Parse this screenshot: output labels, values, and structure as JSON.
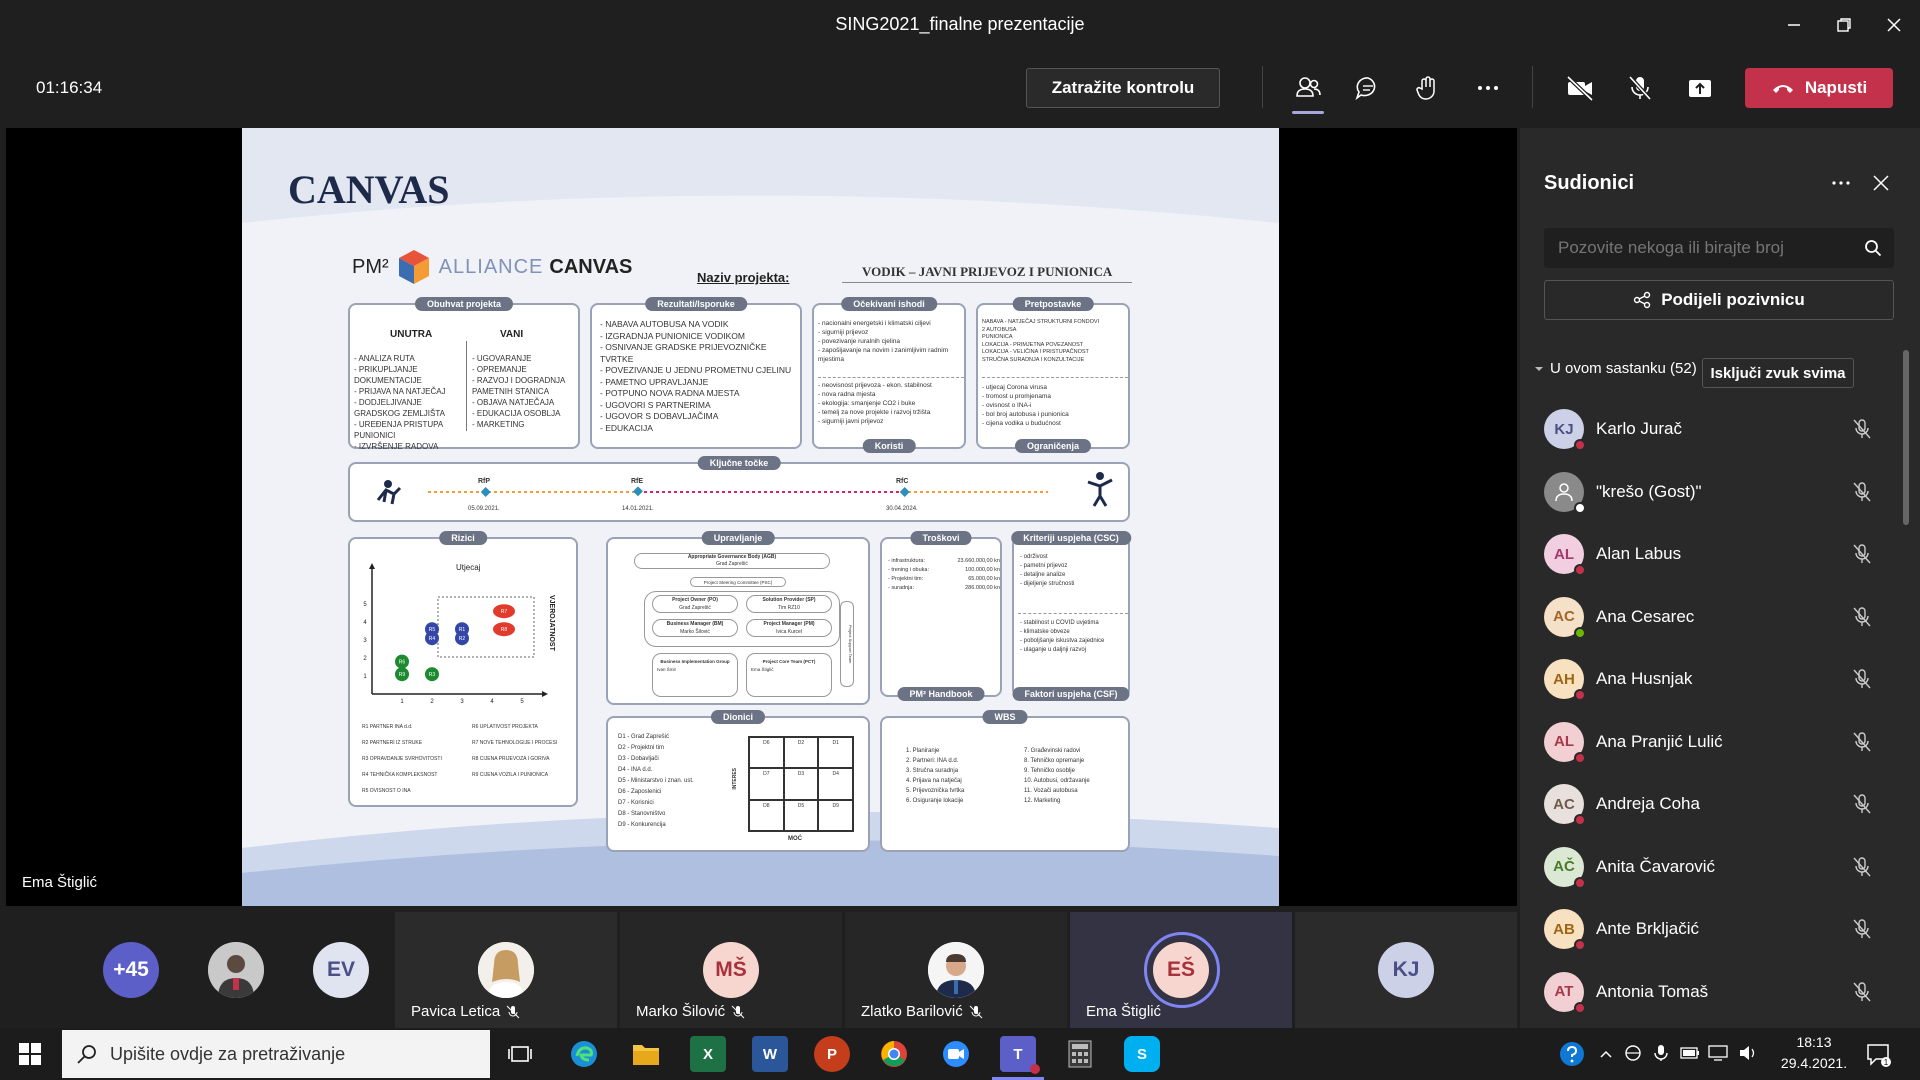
{
  "window": {
    "title": "SING2021_finalne prezentacije"
  },
  "meeting": {
    "timer": "01:16:34",
    "request_control": "Zatražite kontrolu",
    "leave": "Napusti"
  },
  "slide": {
    "title": "CANVAS",
    "logo_pm": "PM²",
    "logo_alliance": "ALLIANCE",
    "logo_canvas": "CANVAS",
    "project_label": "Naziv projekta:",
    "project_name": "VODIK – JAVNI PRIJEVOZ I PUNIONICA",
    "obuhvat": {
      "header": "Obuhvat projekta",
      "col1": "UNUTRA",
      "col2": "VANI",
      "inside": [
        "- ANALIZA RUTA",
        "- PRIKUPLJANJE DOKUMENTACIJE",
        "- PRIJAVA NA NATJEČAJ",
        "- DODJELJIVANJE GRADSKOG ZEMLJIŠTA",
        "- UREĐENJA PRISTUPA PUNIONICI",
        "- IZVRŠENJE RADOVA"
      ],
      "outside": [
        "- UGOVARANJE",
        "- OPREMANJE",
        "- RAZVOJ I DOGRADNJA PAMETNIH STANICA",
        "- OBJAVA NATJEČAJA",
        "- EDUKACIJA OSOBLJA",
        "- MARKETING"
      ]
    },
    "rezultati": {
      "header": "Rezultati/Isporuke",
      "items": [
        "- NABAVA AUTOBUSA NA VODIK",
        "- IZGRADNJA PUNIONICE VODIKOM",
        "- OSNIVANJE GRADSKE PRIJEVOZNIČKE TVRTKE",
        "- POVEZIVANJE U JEDNU PROMETNU CJELINU",
        "- PAMETNO UPRAVLJANJE",
        "- POTPUNO NOVA RADNA MJESTA",
        "- UGOVORI S PARTNERIMA",
        "- UGOVOR S DOBAVLJAČIMA",
        "- EDUKACIJA"
      ]
    },
    "ocekivani": {
      "header": "Očekivani ishodi",
      "footer": "Koristi",
      "top": [
        "- nacionalni energetski i klimatski ciljevi",
        "- sigurniji prijevoz",
        "- povezivanje ruralnih cjelina",
        "- zapošljavanje na novim i zanimljivim radnim mjestima"
      ],
      "bottom": [
        "- neovisnost prijevoza - ekon. stabilnost",
        "- nova radna mjesta",
        "- ekologija: smanjenje CO2 i buke",
        "- temelj za nove projekte i razvoj tržišta",
        "- sigurniji javni prijevoz"
      ]
    },
    "pretpostavke": {
      "header": "Pretpostavke",
      "footer": "Ograničenja",
      "top": [
        "NABAVA - NATJEČAJ STRUKTURNI FONDOVI",
        "2 AUTOBUSA",
        "PUNIONICA",
        "LOKACIJA - PRIMJETNA POVEZANOST",
        "LOKACIJA - VELIČINA I PRISTUPAČNOST",
        "STRUČNA SURADNJA I KONZULTACIJE"
      ],
      "bottom": [
        "- utjecaj Corona virusa",
        "- tromost u promjenama",
        "- ovisnost o INA-i",
        "- bol broj autobusa i punionica",
        "- cijena vodika u budućnost"
      ]
    },
    "kljucne": {
      "header": "Ključne točke",
      "m1": "RfP",
      "d1": "05.09.2021.",
      "m2": "RfE",
      "d2": "14.01.2021.",
      "m3": "RfC",
      "d3": "30.04.2024."
    },
    "rizici": {
      "header": "Rizici",
      "utjecaj": "Utjecaj",
      "vjerojatnost": "VJEROJATNOST",
      "risks": [
        {
          "id": "R1",
          "x": 3,
          "y": 3.6,
          "color": "#3446a8"
        },
        {
          "id": "R2",
          "x": 3,
          "y": 3.1,
          "color": "#3446a8"
        },
        {
          "id": "R3",
          "x": 2,
          "y": 1.1,
          "color": "#1c8a2e"
        },
        {
          "id": "R4",
          "x": 2,
          "y": 3.1,
          "color": "#3446a8"
        },
        {
          "id": "R5",
          "x": 2,
          "y": 3.6,
          "color": "#3446a8"
        },
        {
          "id": "R6",
          "x": 1,
          "y": 1.8,
          "color": "#1c8a2e"
        },
        {
          "id": "R7",
          "x": 4.4,
          "y": 4.6,
          "color": "#e23b2e"
        },
        {
          "id": "R8",
          "x": 4.4,
          "y": 3.6,
          "color": "#e23b2e"
        },
        {
          "id": "R9",
          "x": 1,
          "y": 1.1,
          "color": "#1c8a2e"
        }
      ],
      "legend": [
        "R1 PARTNER INA d.d.",
        "R2 PARTNERI IZ STRUKE",
        "R3 OPRAVDANJE SVRHOVITOSTI",
        "R4 TEHNIČKA KOMPLEKSNOST",
        "R5 OVISNOST O INA",
        "R6 UPLATIVOST PROJEKTA",
        "R7 NOVE TEHNOLOGIJE I PROCESI",
        "R8 CIJENA PRIJEVOZA I GORIVA",
        "R9 CIJENA VOZILA I PUNIONICA"
      ]
    },
    "upravljanje": {
      "header": "Upravljanje",
      "agb": "Appropriate Governance Body (AGB)",
      "agb_sub": "Grad Zaprešić",
      "psc": "Project Steering Committee (PSC)",
      "po": "Project Owner (PO)",
      "po_sub": "Grad Zaprešić",
      "sp": "Solution Provider (SP)",
      "sp_sub": "Tim RZ10",
      "bm": "Business Manager (BM)",
      "bm_sub": "Marko Šilović",
      "pm": "Project Manager (PM)",
      "pm_sub": "Ivica Kurcel",
      "bit": "Business Implementation Group",
      "bit_sub": "Ivan Šmit",
      "plt": "Project Core Team (PCT)",
      "plt_sub": "Ema Štiglić",
      "side": "Project Support Team"
    },
    "troskovi": {
      "header": "Troškovi",
      "footer": "PM² Handbook",
      "rows": [
        [
          "- infrastruktura:",
          "23.660.000,00 kn"
        ],
        [
          "- trening i obuka:",
          "100.000,00 kn"
        ],
        [
          "- Projektni tim:",
          "65.000,00 kn"
        ],
        [
          "- suradnja:",
          "286.000,00 kn"
        ]
      ]
    },
    "kriteriji": {
      "header": "Kriteriji uspjeha (CSC)",
      "footer": "Faktori uspjeha (CSF)",
      "top": [
        "- održivost",
        "- pametni prijevoz",
        "- detaljne analize",
        "- dijeljenje stručnosti"
      ],
      "bottom": [
        "- stabilnost u COVID uvjetima",
        "- klimatske obveze",
        "- poboljšanje iskustva zajednice",
        "- ulaganje u daljnji razvoj"
      ]
    },
    "dionici": {
      "header": "Dionici",
      "interes": "INTERES",
      "moc": "MOĆ",
      "items": [
        "D1 - Grad Zaprešić",
        "D2 - Projektni tim",
        "D3 - Dobavljači",
        "D4 - INA d.d.",
        "D5 - Ministarstvo i znan. ust.",
        "D6 - Zaposlenici",
        "D7 - Korisnici",
        "D8 - Stanovništvo",
        "D9 - Konkurencija"
      ],
      "grid": [
        "D6",
        "D2",
        "D1",
        "D7",
        "D3",
        "D4",
        "D8",
        "D5",
        "D9"
      ]
    },
    "wbs": {
      "header": "WBS",
      "left": [
        "1. Planiranje",
        "2. Partneri: INA d.d.",
        "3. Stručna suradnja",
        "4. Prijava na natječaj",
        "5. Prijevoznička tvrtka",
        "6. Osiguranje lokacije"
      ],
      "right": [
        "7. Građevinski radovi",
        "8. Tehničko opremanje",
        "9. Tehničko osoblje",
        "10. Autobusi, održavanje",
        "11. Vozači autobusa",
        "12. Marketing"
      ]
    }
  },
  "presenter": "Ema Štiglić",
  "panel": {
    "title": "Sudionici",
    "search_placeholder": "Pozovite nekoga ili birajte broj",
    "share": "Podijeli pozivnicu",
    "section": "U ovom sastanku (52)",
    "mute_all": "Isključi zvuk svima",
    "participants": [
      {
        "initials": "KJ",
        "name": "Karlo Jurač",
        "bg": "#ccd1e8",
        "fg": "#4a4f86",
        "status": "#c4314b"
      },
      {
        "initials": "",
        "name": "\"krešo (Gost)\"",
        "bg": "#8a8a8a",
        "fg": "#fff",
        "status": "#ffffff"
      },
      {
        "initials": "AL",
        "name": "Alan Labus",
        "bg": "#f2cfe0",
        "fg": "#a23b6c",
        "status": "#c4314b"
      },
      {
        "initials": "AC",
        "name": "Ana Cesarec",
        "bg": "#f4e1c7",
        "fg": "#a2652a",
        "status": "#6bb700"
      },
      {
        "initials": "AH",
        "name": "Ana Husnjak",
        "bg": "#f7e1c0",
        "fg": "#9e6517",
        "status": "#c4314b"
      },
      {
        "initials": "AL",
        "name": "Ana Pranjić Lulić",
        "bg": "#f2cfd3",
        "fg": "#a83949",
        "status": "#c4314b"
      },
      {
        "initials": "AC",
        "name": "Andreja Coha",
        "bg": "#e7e0dc",
        "fg": "#705a4c",
        "status": "#c4314b"
      },
      {
        "initials": "AČ",
        "name": "Anita Čavarović",
        "bg": "#dbe8d3",
        "fg": "#4a7a2e",
        "status": "#c4314b"
      },
      {
        "initials": "AB",
        "name": "Ante Brkljačić",
        "bg": "#f7e1c0",
        "fg": "#9e6517",
        "status": "#c4314b"
      },
      {
        "initials": "AT",
        "name": "Antonia Tomaš",
        "bg": "#f2cfd3",
        "fg": "#a83949",
        "status": "#c4314b"
      }
    ]
  },
  "strip": {
    "more": "+45",
    "ev": "EV",
    "pavica": "Pavica Letica",
    "ms": "MŠ",
    "marko": "Marko Šilović",
    "zlatko": "Zlatko Barilović",
    "es": "EŠ",
    "ema": "Ema Štiglić",
    "kj": "KJ"
  },
  "taskbar": {
    "search": "Upišite ovdje za pretraživanje",
    "time": "18:13",
    "date": "29.4.2021."
  }
}
